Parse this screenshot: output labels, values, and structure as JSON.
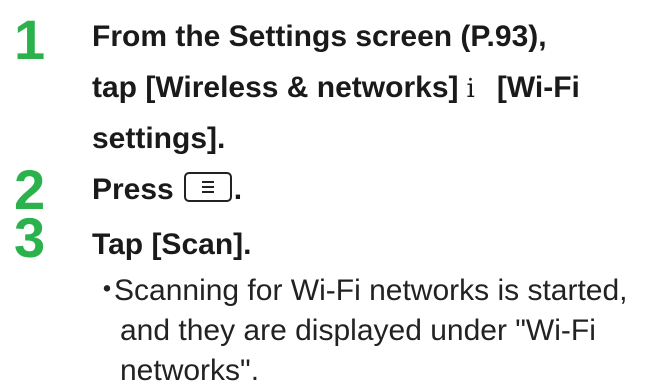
{
  "steps": [
    {
      "number": "1",
      "line1": "From the Settings screen (P.93),",
      "line2_a": "tap [Wireless & networks]",
      "line2_sep": "i",
      "line2_b": "[Wi-Fi",
      "line3": "settings]."
    },
    {
      "number": "2",
      "text": "Press",
      "key_icon": "menu-key-icon",
      "suffix": "."
    },
    {
      "number": "3",
      "text": "Tap [Scan].",
      "bullet": "・",
      "note_lines": [
        "Scanning for Wi-Fi networks is started,",
        "and they are displayed under \"Wi-Fi",
        "networks\"."
      ]
    }
  ],
  "colors": {
    "step_number": "#2bb24c",
    "text": "#1a1a1a"
  }
}
